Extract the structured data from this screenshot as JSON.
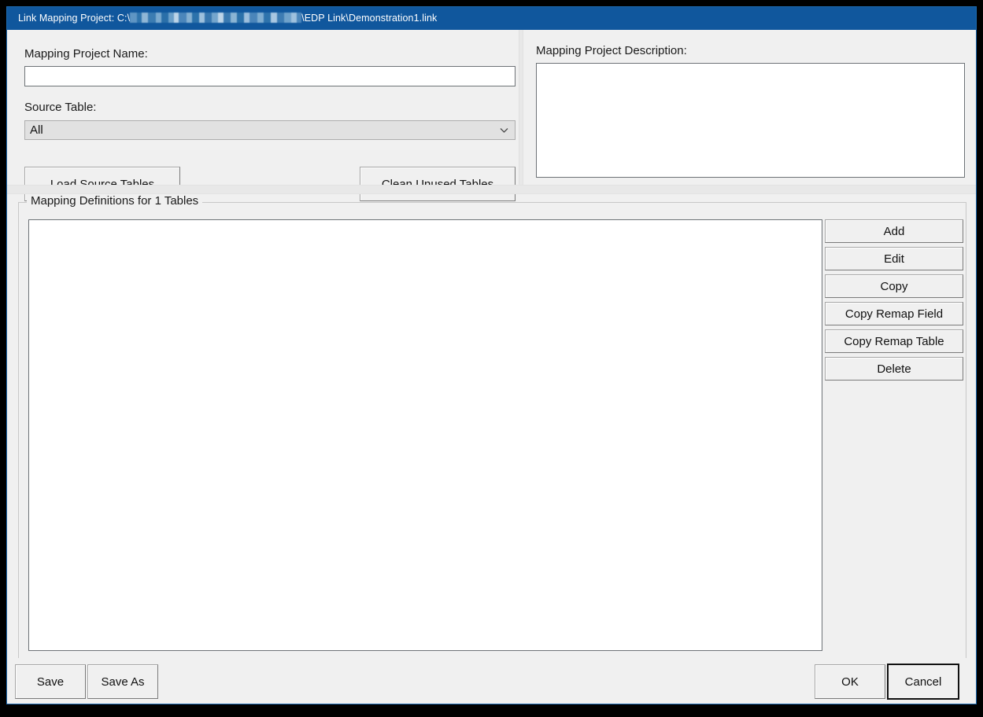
{
  "window": {
    "title_prefix": "Link Mapping Project: C:\\",
    "title_suffix": "\\EDP Link\\Demonstration1.link",
    "titlebar_color": "#10579d",
    "frame_color": "#1d6ab0",
    "surface_color": "#f0f0f0"
  },
  "left_panel": {
    "project_name_label": "Mapping Project Name:",
    "project_name_value": "",
    "project_name_placeholder": "",
    "source_table_label": "Source Table:",
    "source_table_selected": "All",
    "source_table_options": [
      "All"
    ],
    "load_source_tables_button": "Load Source Tables",
    "clean_unused_tables_button": "Clean Unused Tables"
  },
  "right_panel": {
    "description_label": "Mapping Project Description:",
    "description_value": "",
    "description_placeholder": ""
  },
  "mapping_group": {
    "title": "Mapping Definitions for 1 Tables",
    "table_count": 1,
    "list_items": [],
    "buttons": [
      {
        "label": "Add",
        "name": "add-button"
      },
      {
        "label": "Edit",
        "name": "edit-button"
      },
      {
        "label": "Copy",
        "name": "copy-button"
      },
      {
        "label": "Copy Remap Field",
        "name": "copy-remap-field-button"
      },
      {
        "label": "Copy Remap Table",
        "name": "copy-remap-table-button"
      },
      {
        "label": "Delete",
        "name": "delete-button"
      }
    ]
  },
  "bottom_bar": {
    "save_label": "Save",
    "save_as_label": "Save As",
    "ok_label": "OK",
    "cancel_label": "Cancel",
    "default_button": "Cancel"
  }
}
